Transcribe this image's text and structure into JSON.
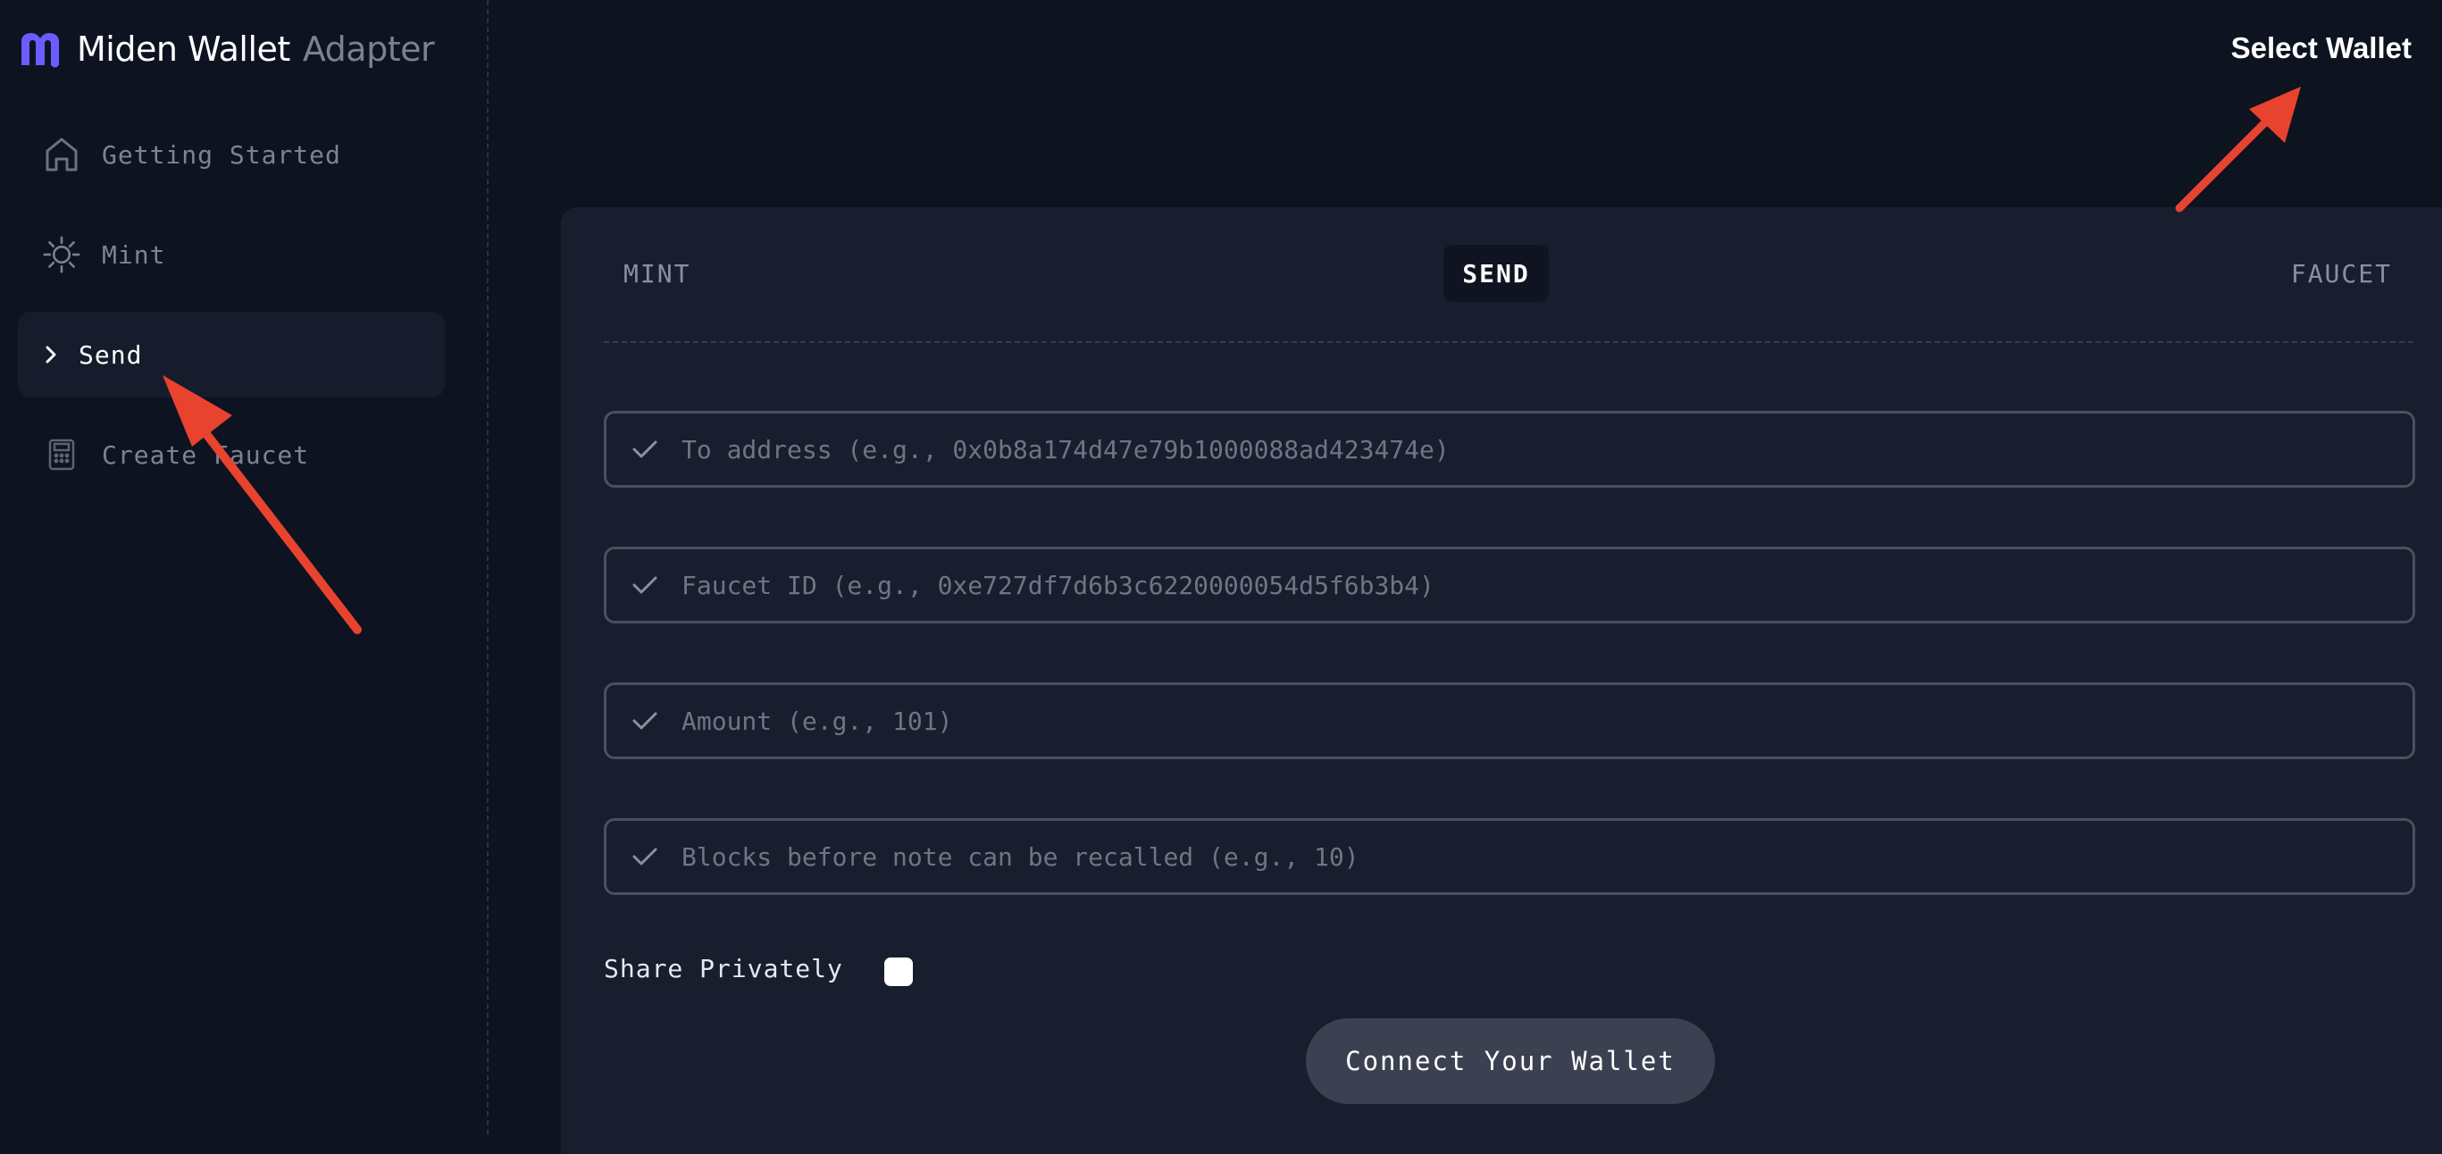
{
  "brand": {
    "name": "Miden Wallet",
    "suffix": "Adapter"
  },
  "sidebar": {
    "items": [
      {
        "label": "Getting Started",
        "icon": "home-icon"
      },
      {
        "label": "Mint",
        "icon": "sun-icon"
      },
      {
        "label": "Send",
        "icon": "chevron-right-icon",
        "active": true
      },
      {
        "label": "Create Faucet",
        "icon": "calculator-icon"
      }
    ]
  },
  "header": {
    "select_wallet": "Select Wallet"
  },
  "tabs": {
    "mint": "MINT",
    "send": "SEND",
    "faucet": "FAUCET"
  },
  "form": {
    "to_address_placeholder": "To address (e.g., 0x0b8a174d47e79b1000088ad423474e)",
    "faucet_id_placeholder": "Faucet ID (e.g., 0xe727df7d6b3c6220000054d5f6b3b4)",
    "amount_placeholder": "Amount (e.g., 101)",
    "recall_blocks_placeholder": "Blocks before note can be recalled (e.g., 10)",
    "share_privately_label": "Share Privately",
    "connect_button": "Connect Your Wallet"
  },
  "colors": {
    "background": "#0e1320",
    "panel": "#181e2d",
    "brand_purple": "#6a5cff",
    "annotation_red": "#e8432f"
  }
}
